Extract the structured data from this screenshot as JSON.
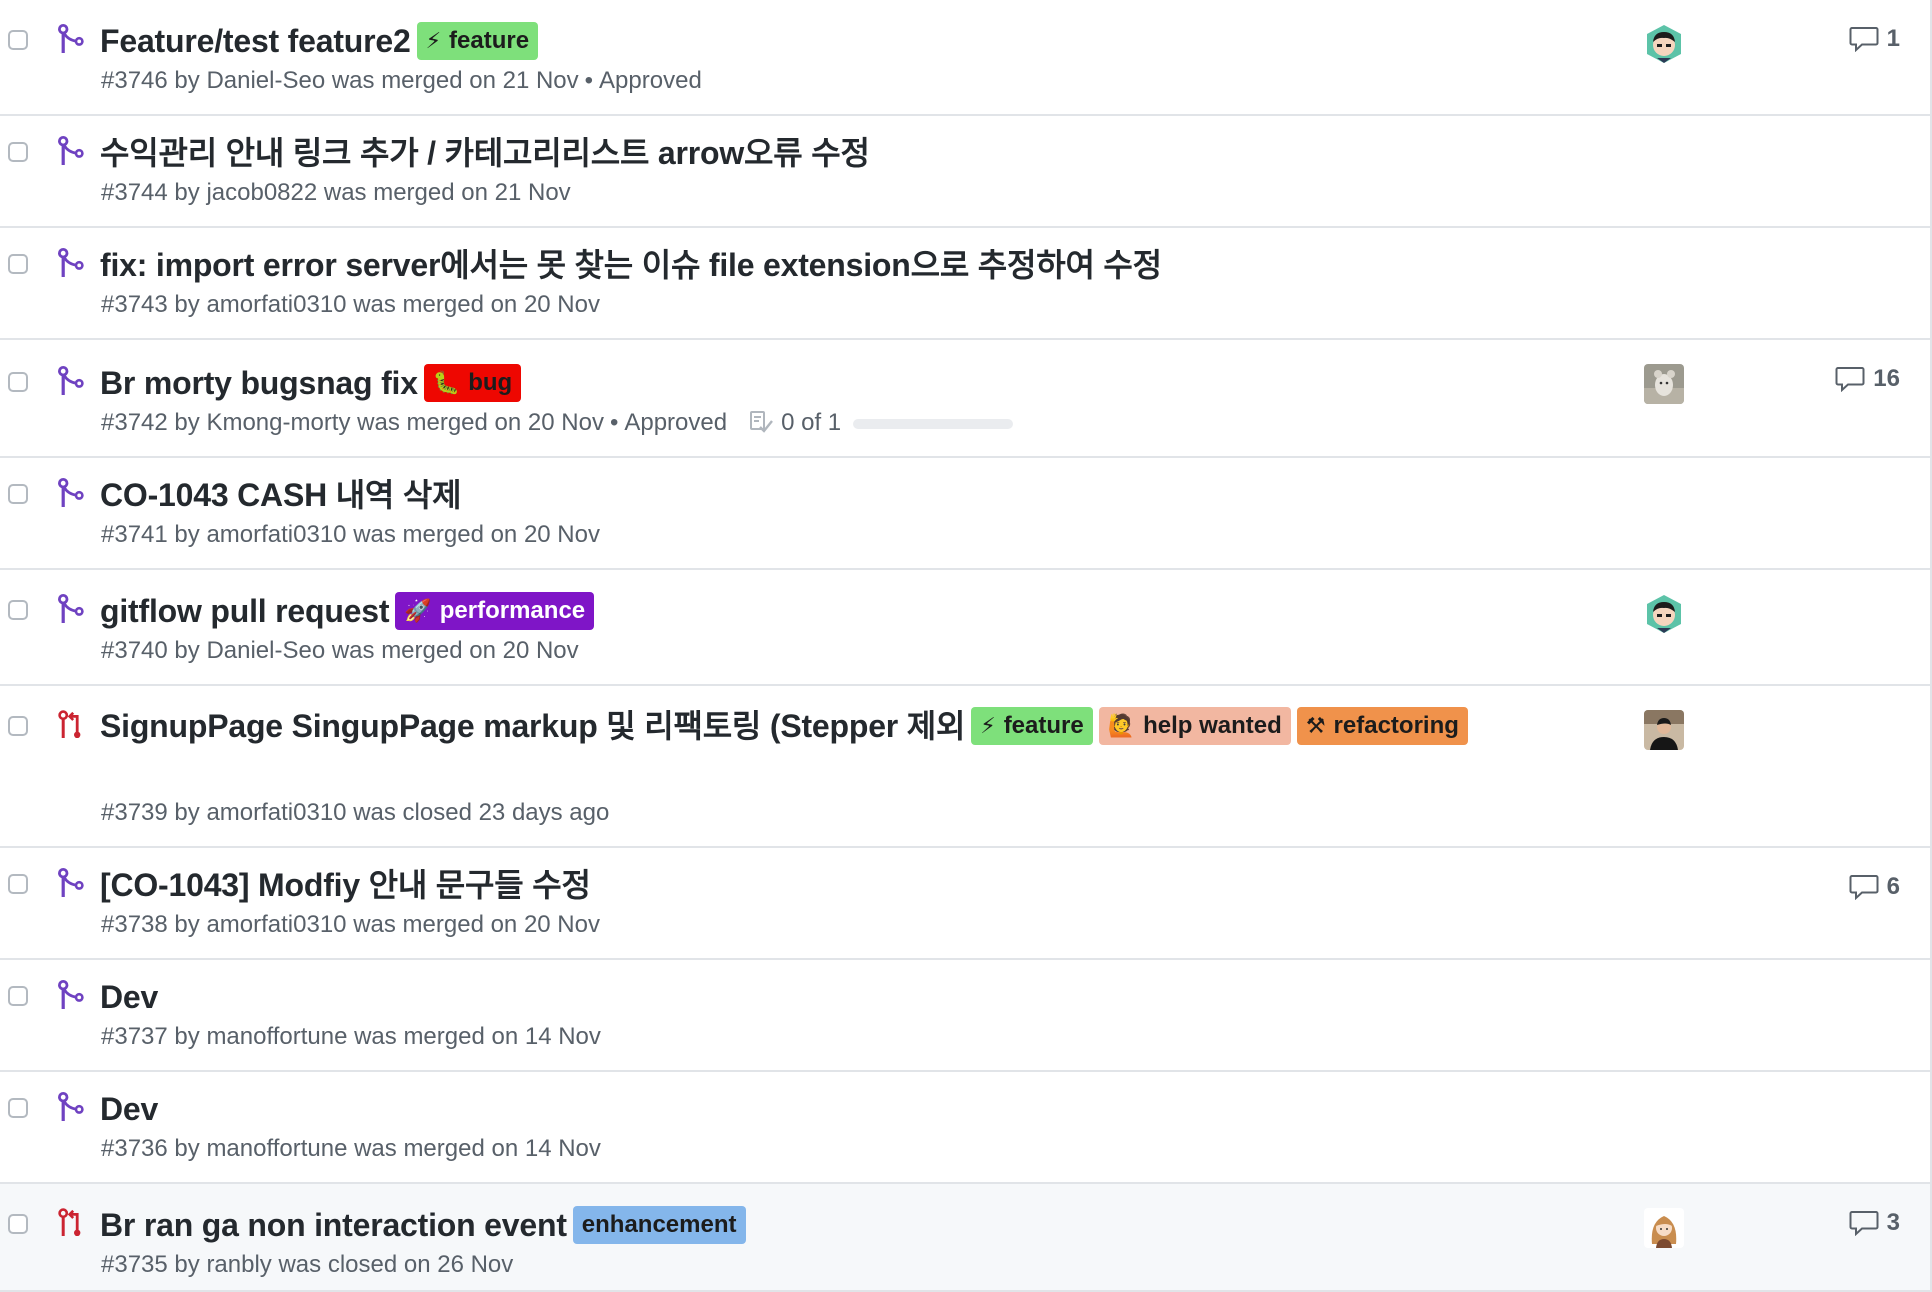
{
  "colors": {
    "merged": "#6f42c1",
    "closed": "#cb2431",
    "meta_text": "#586069"
  },
  "items": [
    {
      "state": "merged",
      "title": "Feature/test feature2",
      "labels": [
        {
          "name": "feature",
          "emoji": "⚡",
          "bg": "#7ee07b",
          "fg": "#1c1c1c"
        }
      ],
      "number": "#3746",
      "meta": "by Daniel-Seo was merged on 21 Nov",
      "review": "Approved",
      "avatar": "avatar-green",
      "comments": "1"
    },
    {
      "state": "merged",
      "title": "수익관리 안내 링크 추가 / 카테고리리스트 arrow오류 수정",
      "labels": [],
      "number": "#3744",
      "meta": "by jacob0822 was merged on 21 Nov"
    },
    {
      "state": "merged",
      "title": "fix: import error server에서는 못 찾는 이슈 file extension으로 추정하여 수정",
      "labels": [],
      "number": "#3743",
      "meta": "by amorfati0310 was merged on 20 Nov"
    },
    {
      "state": "merged",
      "title": "Br morty bugsnag fix",
      "labels": [
        {
          "name": "bug",
          "emoji": "🐛",
          "bg": "#ee0701",
          "fg": "#1c1c1c"
        }
      ],
      "number": "#3742",
      "meta": "by Kmong-morty was merged on 20 Nov",
      "review": "Approved",
      "tasks": "0 of 1",
      "tasks_progress": 0,
      "avatar": "avatar-photo",
      "comments": "16"
    },
    {
      "state": "merged",
      "title": "CO-1043 CASH 내역 삭제",
      "labels": [],
      "number": "#3741",
      "meta": "by amorfati0310 was merged on 20 Nov"
    },
    {
      "state": "merged",
      "title": "gitflow pull request",
      "labels": [
        {
          "name": "performance",
          "emoji": "🚀",
          "bg": "#7f15c7",
          "fg": "#ffffff"
        }
      ],
      "number": "#3740",
      "meta": "by Daniel-Seo was merged on 20 Nov",
      "avatar": "avatar-green"
    },
    {
      "state": "closed",
      "title": "SignupPage SingupPage markup 및 리팩토링 (Stepper 제외",
      "labels": [
        {
          "name": "feature",
          "emoji": "⚡",
          "bg": "#7ee07b",
          "fg": "#1c1c1c"
        },
        {
          "name": "help wanted",
          "emoji": "🙋",
          "bg": "#f2b7a1",
          "fg": "#1c1c1c"
        },
        {
          "name": "refactoring",
          "emoji": "⚒",
          "bg": "#f0924b",
          "fg": "#1c1c1c"
        }
      ],
      "number": "#3739",
      "meta": "by amorfati0310 was closed 23 days ago",
      "avatar": "avatar-person"
    },
    {
      "state": "merged",
      "title": "[CO-1043] Modfiy 안내 문구들 수정",
      "labels": [],
      "number": "#3738",
      "meta": "by amorfati0310 was merged on 20 Nov",
      "comments": "6"
    },
    {
      "state": "merged",
      "title": "Dev",
      "labels": [],
      "number": "#3737",
      "meta": "by manoffortune was merged on 14 Nov"
    },
    {
      "state": "merged",
      "title": "Dev",
      "labels": [],
      "number": "#3736",
      "meta": "by manoffortune was merged on 14 Nov"
    },
    {
      "state": "closed",
      "title": "Br ran ga non interaction event",
      "labels": [
        {
          "name": "enhancement",
          "emoji": "",
          "bg": "#84b6eb",
          "fg": "#1c1c1c"
        }
      ],
      "number": "#3735",
      "meta": "by ranbly was closed on 26 Nov",
      "avatar": "avatar-girl",
      "comments": "3"
    }
  ]
}
